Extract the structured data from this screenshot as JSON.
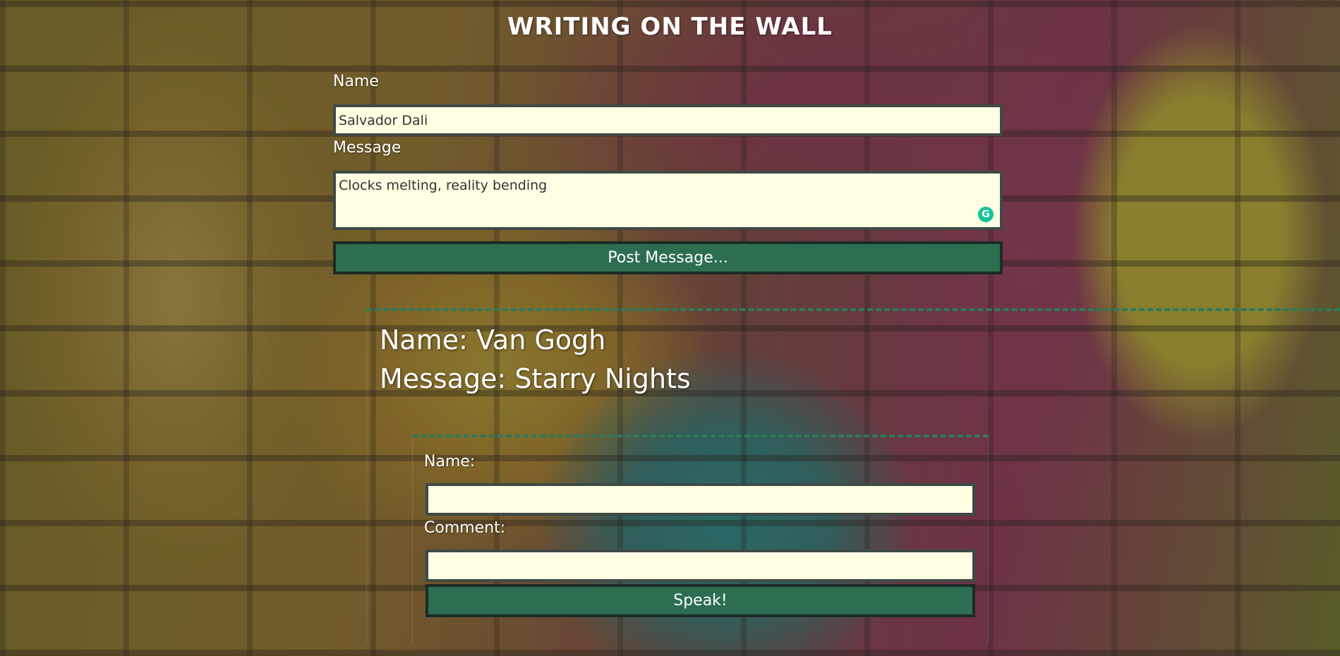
{
  "page": {
    "title": "WRITING ON THE WALL"
  },
  "post_form": {
    "name_label": "Name",
    "name_value": "Salvador Dali",
    "message_label": "Message",
    "message_value": "Clocks melting, reality bending",
    "submit_label": "Post Message..."
  },
  "posts": [
    {
      "name_line": "Name: Van Gogh",
      "message_line": "Message: Starry Nights",
      "comment_form": {
        "name_label": "Name:",
        "name_value": "",
        "comment_label": "Comment:",
        "comment_value": "",
        "submit_label": "Speak!"
      }
    }
  ],
  "icons": {
    "grammarly": "grammarly-icon"
  },
  "colors": {
    "button_bg": "#2c6e4f",
    "field_bg": "#fefee3",
    "divider": "#2d7a58"
  }
}
